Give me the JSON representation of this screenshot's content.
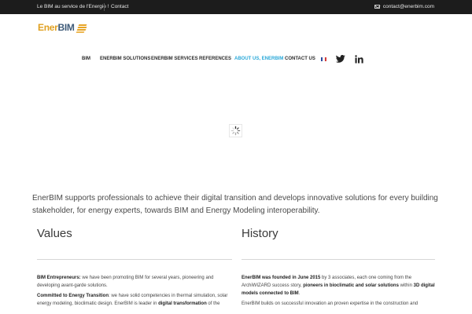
{
  "topbar": {
    "tagline": "Le BIM au service de l'Energie !",
    "contact_link": "Contact",
    "email": "contact@enerbim.com"
  },
  "logo": {
    "part1": "Ener",
    "part2": "BIM"
  },
  "nav": {
    "items": [
      "BIM",
      "ENERBIM SOLUTIONS",
      "ENERBIM SERVICES",
      "REFERENCES",
      "ABOUT US, ENERBIM",
      "CONTACT US"
    ],
    "active_index": 4
  },
  "colors": {
    "accent": "#29a8d8",
    "brand_orange": "#e0a020",
    "brand_blue": "#3d5a78",
    "topbar_bg": "#1c1c1c"
  },
  "intro": "EnerBIM supports professionals to achieve their digital transition and develops innovative solutions for every building stakeholder, for energy experts, towards BIM and Energy Modeling interoperability.",
  "values": {
    "title": "Values",
    "p1_bold": "BIM Entrepreneurs:",
    "p1_text": " we have been promoting BIM for several years, pioneering and developing avant-garde solutions.",
    "p2_bold": "Committed to Energy Transition",
    "p2_text": ": we have solid competencies in thermal simulation, solar energy modeling, bioclimatic design. EnerBIM is leader in ",
    "p2_bold2": "digital transformation",
    "p2_text2": " of the"
  },
  "history": {
    "title": "History",
    "p1_bold": "EnerBIM was founded in June 2015",
    "p1_text": " by 3 associates, each one coming from the ArchiWIZARD success story, ",
    "p1_bold2": "pioneers in bioclimatic and solar solutions",
    "p1_text2": " within ",
    "p1_bold3": "3D digital models connected to BIM",
    "p1_text3": ".",
    "p2_text": "EnerBIM builds on successful innovation an proven expertise in the construction and"
  }
}
